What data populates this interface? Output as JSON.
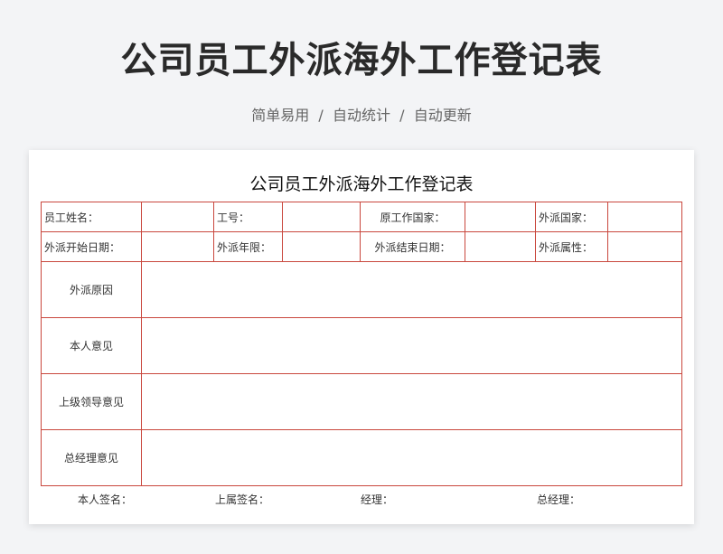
{
  "header": {
    "title": "公司员工外派海外工作登记表",
    "subtitle": "简单易用  /  自动统计  /  自动更新"
  },
  "form": {
    "title": "公司员工外派海外工作登记表",
    "row1": [
      "员工姓名：",
      "工号：",
      "原工作国家：",
      "外派国家："
    ],
    "row2": [
      "外派开始日期：",
      "外派年限：",
      "外派结束日期：",
      "外派属性："
    ],
    "sections": [
      "外派原因",
      "本人意见",
      "上级领导意见",
      "总经理意见"
    ],
    "signatures": [
      "本人签名：",
      "上属签名：",
      "经理：",
      "总经理："
    ]
  }
}
